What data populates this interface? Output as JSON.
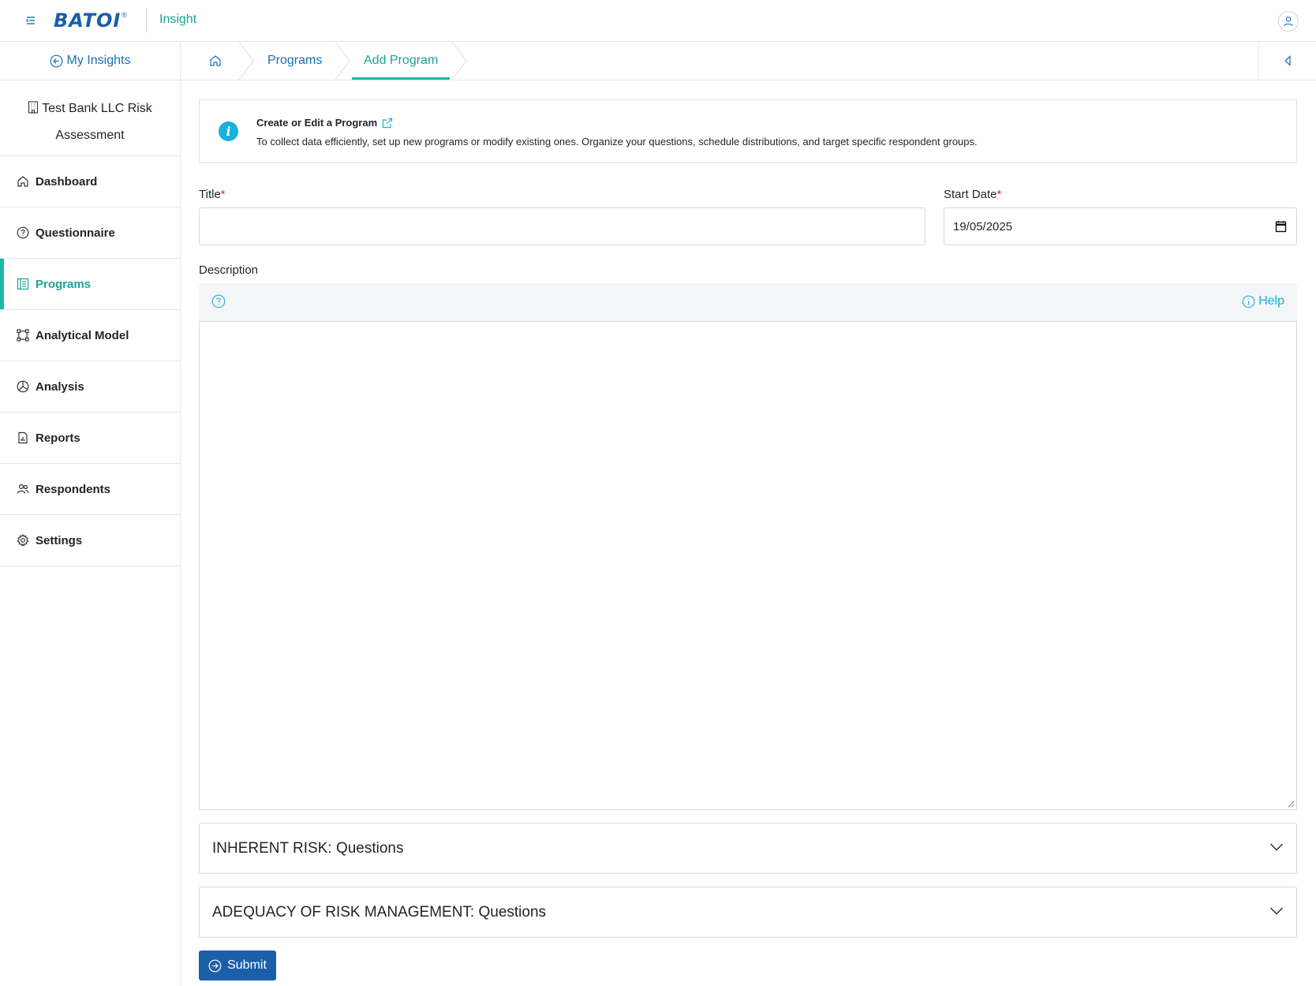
{
  "header": {
    "logo_text": "BATOI",
    "logo_reg": "®",
    "app_name": "Insight"
  },
  "sidebar": {
    "back_link": "My Insights",
    "org_name": "Test Bank LLC Risk Assessment",
    "active_item": "Programs",
    "items": [
      {
        "label": "Dashboard",
        "icon": "home-icon"
      },
      {
        "label": "Questionnaire",
        "icon": "question-circle-icon"
      },
      {
        "label": "Programs",
        "icon": "list-doc-icon"
      },
      {
        "label": "Analytical Model",
        "icon": "nodes-icon"
      },
      {
        "label": "Analysis",
        "icon": "pie-icon"
      },
      {
        "label": "Reports",
        "icon": "report-icon"
      },
      {
        "label": "Respondents",
        "icon": "people-icon"
      },
      {
        "label": "Settings",
        "icon": "gear-icon"
      }
    ]
  },
  "breadcrumb": {
    "items": [
      "Programs",
      "Add Program"
    ]
  },
  "info": {
    "title": "Create or Edit a Program",
    "description": "To collect data efficiently, set up new programs or modify existing ones. Organize your questions, schedule distributions, and target specific respondent groups."
  },
  "form": {
    "title_label": "Title",
    "title_value": "",
    "start_date_label": "Start Date",
    "start_date_value": "19/05/2025",
    "required_mark": "*",
    "description_label": "Description",
    "help_label": "Help",
    "sections": [
      "INHERENT RISK: Questions",
      "ADEQUACY OF RISK MANAGEMENT: Questions"
    ],
    "submit_label": "Submit"
  },
  "colors": {
    "brand_blue": "#1a5fa8",
    "accent_teal": "#1aa39a",
    "info_cyan": "#16b3d8",
    "required_red": "#d7262e"
  }
}
